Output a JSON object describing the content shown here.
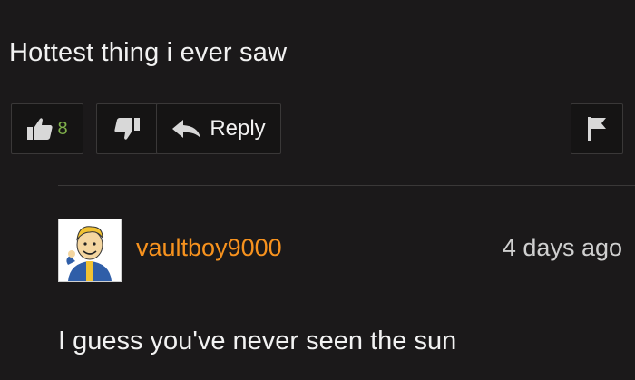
{
  "comment": {
    "text": "Hottest thing i ever saw",
    "like_count": "8",
    "reply_label": "Reply"
  },
  "reply": {
    "username": "vaultboy9000",
    "timestamp": "4 days ago",
    "text": "I guess you've never seen the sun"
  },
  "icons": {
    "like": "thumbs-up-icon",
    "dislike": "thumbs-down-icon",
    "reply": "reply-arrow-icon",
    "flag": "flag-icon"
  },
  "colors": {
    "background": "#1b191a",
    "like_count": "#7fb04b",
    "username": "#f7921e"
  }
}
